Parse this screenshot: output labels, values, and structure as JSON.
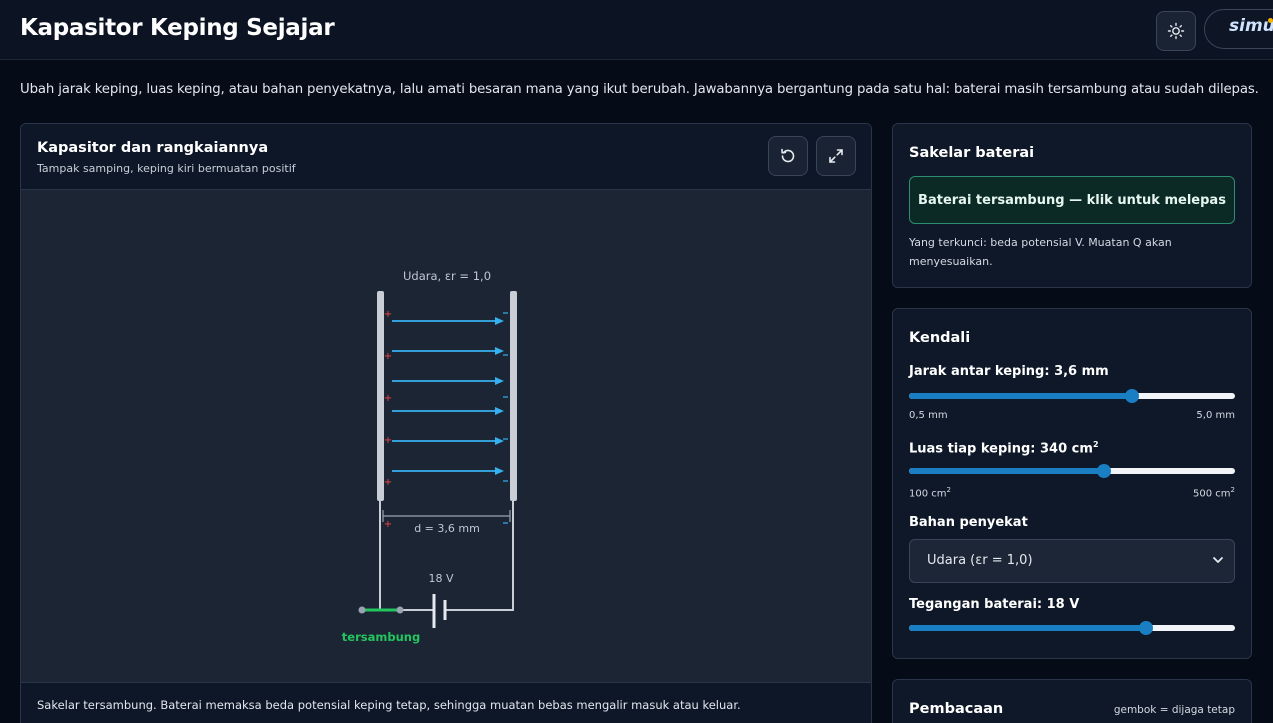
{
  "header": {
    "title": "Kapasitor Keping Sejajar",
    "theme_icon": "sun-icon",
    "brand": "simu"
  },
  "intro": "Ubah jarak keping, luas keping, atau bahan penyekatnya, lalu amati besaran mana yang ikut berubah. Jawabannya bergantung pada satu hal: baterai masih tersambung atau sudah dilepas.",
  "sim": {
    "title": "Kapasitor dan rangkaiannya",
    "subtitle": "Tampak samping, keping kiri bermuatan positif",
    "reset_icon": "reset-icon",
    "fullscreen_icon": "expand-icon",
    "dielectric_label": "Udara, εr = 1,0",
    "gap_label": "d = 3,6 mm",
    "battery_label": "18 V",
    "switch_label": "tersambung",
    "field_line_count": 6,
    "status_text": "Sakelar tersambung. Baterai memaksa beda potensial keping tetap, sehingga muatan bebas mengalir masuk atau keluar.",
    "colors": {
      "field": "#37b0f0",
      "plate": "#c9ced6",
      "switch_closed": "#22c55e",
      "plus": "#ef4444"
    }
  },
  "battery_switch": {
    "title": "Sakelar baterai",
    "button_label": "Baterai tersambung — klik untuk melepas",
    "note": "Yang terkunci: beda potensial V. Muatan Q akan menyesuaikan."
  },
  "controls": {
    "title": "Kendali",
    "distance": {
      "label": "Jarak antar keping: 3,6 mm",
      "min_label": "0,5 mm",
      "max_label": "5,0 mm",
      "fraction": 0.683
    },
    "area": {
      "label_main": "Luas tiap keping: 340 cm",
      "label_sup": "2",
      "min_label": "100 cm",
      "max_label": "500 cm",
      "unit_sup": "2",
      "fraction": 0.597
    },
    "material": {
      "label": "Bahan penyekat",
      "selected": "Udara (εr = 1,0)"
    },
    "voltage": {
      "label": "Tegangan baterai: 18 V",
      "fraction": 0.727
    }
  },
  "readouts": {
    "title": "Pembacaan",
    "note": "gembok = dijaga tetap"
  }
}
